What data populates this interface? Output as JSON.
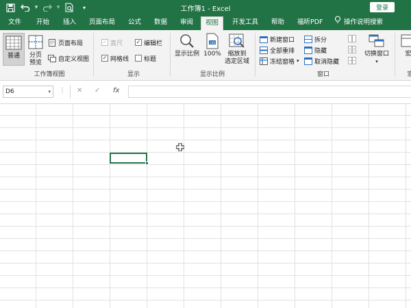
{
  "window": {
    "title": "工作簿1  -  Excel",
    "login_label": "登录"
  },
  "quick_access": {
    "icons": [
      "save-icon",
      "undo-icon",
      "redo-icon",
      "print-preview-icon",
      "customize-qat-icon"
    ]
  },
  "tabs": [
    {
      "label": "文件",
      "active": false
    },
    {
      "label": "开始",
      "active": false
    },
    {
      "label": "插入",
      "active": false
    },
    {
      "label": "页面布局",
      "active": false
    },
    {
      "label": "公式",
      "active": false
    },
    {
      "label": "数据",
      "active": false
    },
    {
      "label": "审阅",
      "active": false
    },
    {
      "label": "视图",
      "active": true
    },
    {
      "label": "开发工具",
      "active": false
    },
    {
      "label": "帮助",
      "active": false
    },
    {
      "label": "福昕PDF",
      "active": false
    }
  ],
  "tell_me": "操作说明搜索",
  "ribbon": {
    "workbook_views": {
      "label": "工作簿视图",
      "normal": "普通",
      "page_break_line1": "分页",
      "page_break_line2": "预览",
      "page_layout": "页面布局",
      "custom_views": "自定义视图"
    },
    "show": {
      "label": "显示",
      "ruler": "直尺",
      "formula_bar": "编辑栏",
      "gridlines": "网格线",
      "headings": "标题",
      "ruler_checked": true,
      "formula_bar_checked": true,
      "gridlines_checked": true,
      "headings_checked": false
    },
    "zoom": {
      "label": "显示比例",
      "zoom": "显示比例",
      "hundred": "100%",
      "zoom_selection_line1": "缩放到",
      "zoom_selection_line2": "选定区域"
    },
    "window": {
      "label": "窗口",
      "new_window": "新建窗口",
      "arrange_all": "全部重排",
      "freeze_panes": "冻结窗格",
      "split": "拆分",
      "hide": "隐藏",
      "unhide": "取消隐藏",
      "switch_windows": "切换窗口",
      "macros_partial": "宏"
    }
  },
  "formula_bar": {
    "name_box": "D6",
    "cancel": "✕",
    "enter": "✓",
    "fx": "fx",
    "content": ""
  },
  "sheet": {
    "active_cell": "D6"
  },
  "colors": {
    "accent": "#217346",
    "ribbon_bg": "#f3f3f3",
    "gridline": "#e1e1e1"
  }
}
